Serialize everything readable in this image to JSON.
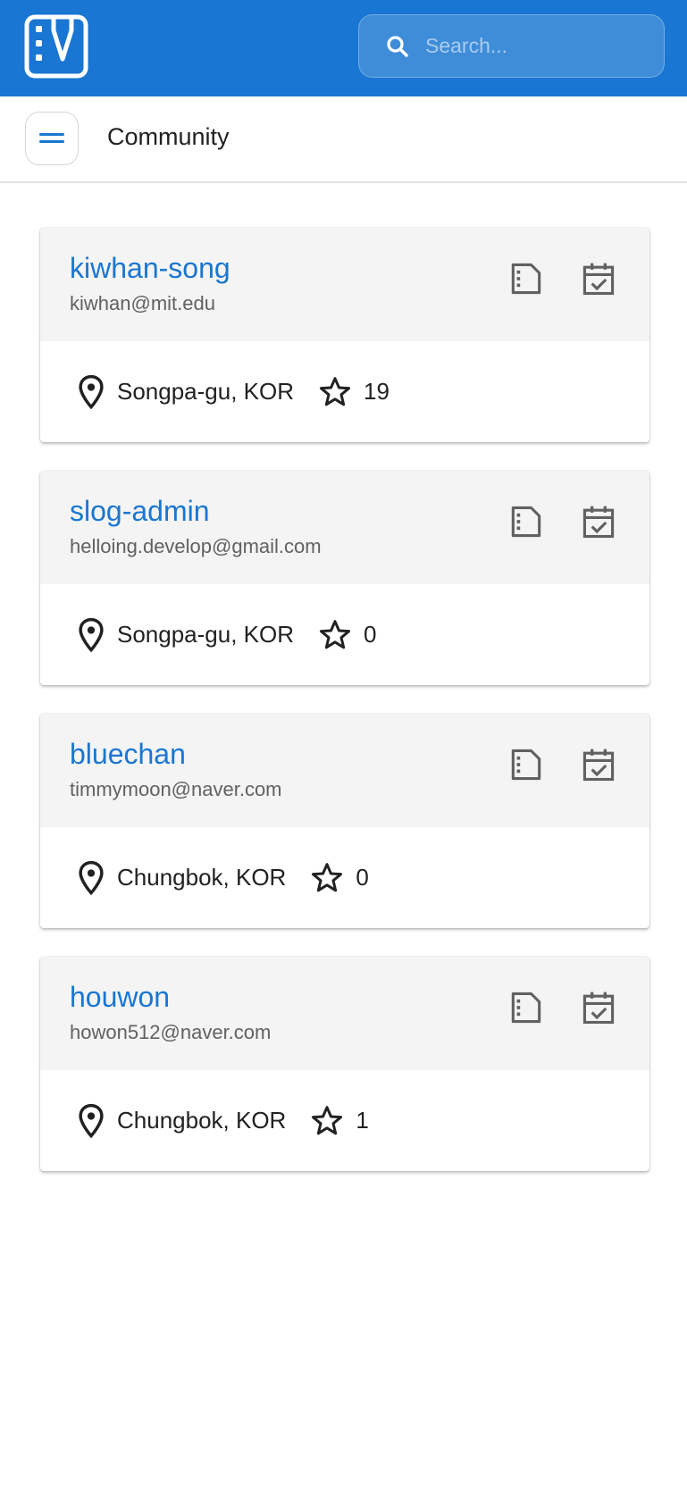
{
  "header": {
    "search_placeholder": "Search..."
  },
  "toolbar": {
    "title": "Community"
  },
  "users": [
    {
      "name": "kiwhan-song",
      "email": "kiwhan@mit.edu",
      "location": "Songpa-gu, KOR",
      "stars": "19"
    },
    {
      "name": "slog-admin",
      "email": "helloing.develop@gmail.com",
      "location": "Songpa-gu, KOR",
      "stars": "0"
    },
    {
      "name": "bluechan",
      "email": "timmymoon@naver.com",
      "location": "Chungbok, KOR",
      "stars": "0"
    },
    {
      "name": "houwon",
      "email": "howon512@naver.com",
      "location": "Chungbok, KOR",
      "stars": "1"
    }
  ],
  "icons": {
    "logo": "slog-logo-icon",
    "search": "search-icon",
    "menu": "menu-icon",
    "posts": "document-icon",
    "calendar": "calendar-check-icon",
    "location": "location-pin-icon",
    "star": "star-outline-icon"
  },
  "colors": {
    "primary": "#1976d2",
    "card_header": "#f4f4f4",
    "icon_gray": "#616161"
  }
}
